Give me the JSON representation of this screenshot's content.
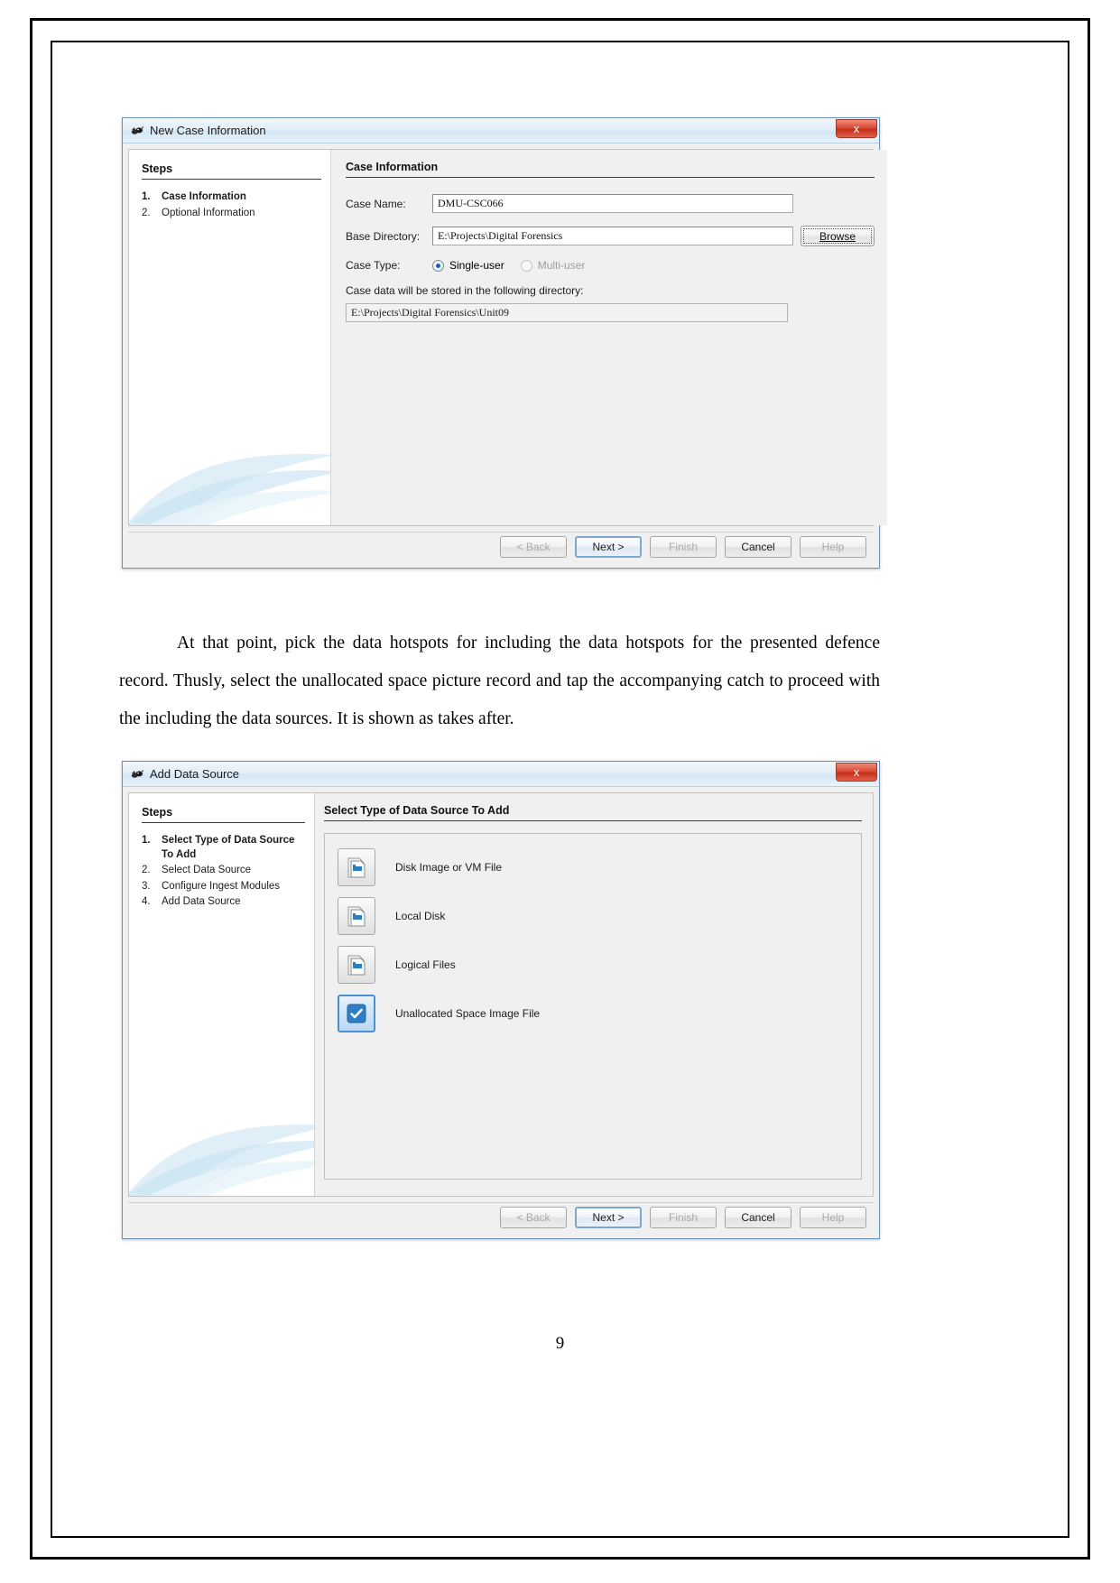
{
  "document": {
    "page_number": "9",
    "paragraph": "At that point, pick the data hotspots for including the data hotspots for the presented defence record. Thusly, select the unallocated space picture record and tap the accompanying catch to proceed with the including the data sources. It is shown as takes after."
  },
  "dialog_new_case": {
    "title": "New Case Information",
    "close_label": "x",
    "steps_header": "Steps",
    "steps": [
      {
        "num": "1.",
        "label": "Case Information",
        "current": true
      },
      {
        "num": "2.",
        "label": "Optional Information",
        "current": false
      }
    ],
    "content_header": "Case Information",
    "fields": {
      "case_name_label": "Case Name:",
      "case_name_value": "DMU-CSC066",
      "base_directory_label": "Base Directory:",
      "base_directory_value": "E:\\Projects\\Digital Forensics",
      "browse_label": "Browse",
      "case_type_label": "Case Type:",
      "case_type_options": [
        {
          "label": "Single-user",
          "checked": true,
          "disabled": false
        },
        {
          "label": "Multi-user",
          "checked": false,
          "disabled": true
        }
      ],
      "storage_hint": "Case data will be stored in the following directory:",
      "storage_path": "E:\\Projects\\Digital Forensics\\Unit09"
    },
    "buttons": [
      {
        "label": "< Back",
        "state": "disabled"
      },
      {
        "label": "Next >",
        "state": "default"
      },
      {
        "label": "Finish",
        "state": "disabled"
      },
      {
        "label": "Cancel",
        "state": "normal"
      },
      {
        "label": "Help",
        "state": "disabled"
      }
    ]
  },
  "dialog_add_data_source": {
    "title": "Add Data Source",
    "close_label": "x",
    "steps_header": "Steps",
    "steps": [
      {
        "num": "1.",
        "label": "Select Type of Data Source To Add",
        "current": true
      },
      {
        "num": "2.",
        "label": "Select Data Source",
        "current": false
      },
      {
        "num": "3.",
        "label": "Configure Ingest Modules",
        "current": false
      },
      {
        "num": "4.",
        "label": "Add Data Source",
        "current": false
      }
    ],
    "content_header": "Select Type of Data Source To Add",
    "source_types": [
      {
        "label": "Disk Image or VM File",
        "icon": "disk-image-icon",
        "selected": false
      },
      {
        "label": "Local Disk",
        "icon": "local-disk-icon",
        "selected": false
      },
      {
        "label": "Logical Files",
        "icon": "logical-files-icon",
        "selected": false
      },
      {
        "label": "Unallocated Space Image File",
        "icon": "unallocated-space-icon",
        "selected": true
      }
    ],
    "buttons": [
      {
        "label": "< Back",
        "state": "disabled"
      },
      {
        "label": "Next >",
        "state": "default"
      },
      {
        "label": "Finish",
        "state": "disabled"
      },
      {
        "label": "Cancel",
        "state": "normal"
      },
      {
        "label": "Help",
        "state": "disabled"
      }
    ]
  },
  "colors": {
    "title_bar": "#d3e6f5",
    "close_button": "#c3301a",
    "selection_blue": "#4a8fd0",
    "radio_accent": "#1a5fb4"
  }
}
